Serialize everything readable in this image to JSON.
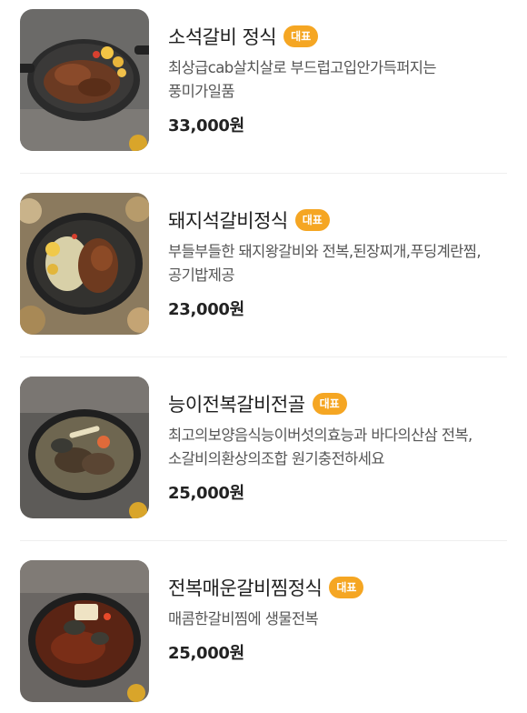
{
  "menu": {
    "items": [
      {
        "title": "소석갈비 정식",
        "badge": "대표",
        "description": "최상급cab살치살로 부드럽고입안가득퍼지는 풍미가일품",
        "price": "33,000원"
      },
      {
        "title": "돼지석갈비정식",
        "badge": "대표",
        "description": "부들부들한 돼지왕갈비와 전복,된장찌개,푸딩계란찜,공기밥제공",
        "price": "23,000원"
      },
      {
        "title": "능이전복갈비전골",
        "badge": "대표",
        "description": "최고의보양음식능이버섯의효능과 바다의산삼 전복,소갈비의환상의조합 원기충전하세요",
        "price": "25,000원"
      },
      {
        "title": "전복매운갈비찜정식",
        "badge": "대표",
        "description": "매콤한갈비찜에 생물전복",
        "price": "25,000원"
      }
    ]
  },
  "colors": {
    "badge": "#f5a623",
    "title": "#1e1e1e",
    "description": "#555555",
    "price": "#222222"
  }
}
